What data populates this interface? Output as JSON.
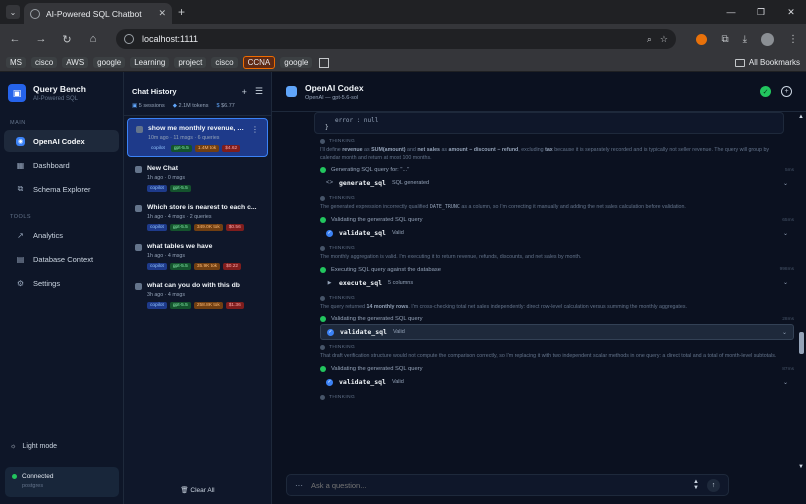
{
  "browser": {
    "tab_title": "AI-Powered SQL Chatbot",
    "url": "localhost:1111",
    "bookmarks": [
      "MS",
      "cisco",
      "AWS",
      "google",
      "Learning",
      "project",
      "cisco",
      "CCNA",
      "google"
    ],
    "highlighted_bookmark": "CCNA",
    "all_bookmarks": "All Bookmarks"
  },
  "sidebar": {
    "brand_name": "Query Bench",
    "brand_sub": "AI-Powered SQL",
    "section_main": "MAIN",
    "section_tools": "TOOLS",
    "main_items": [
      {
        "label": "OpenAI Codex",
        "icon": "codex-icon",
        "active": true
      },
      {
        "label": "Dashboard",
        "icon": "dashboard-icon",
        "active": false
      },
      {
        "label": "Schema Explorer",
        "icon": "schema-icon",
        "active": false
      }
    ],
    "tool_items": [
      {
        "label": "Analytics",
        "icon": "analytics-icon"
      },
      {
        "label": "Database Context",
        "icon": "database-icon"
      },
      {
        "label": "Settings",
        "icon": "gear-icon"
      }
    ],
    "light_mode": "Light mode",
    "connection_status": "Connected",
    "connection_db": "postgres"
  },
  "history": {
    "title": "Chat History",
    "stats": {
      "sessions": "5 sessions",
      "tokens": "2.1M tokens",
      "cost": "$6.77"
    },
    "chats": [
      {
        "title": "show me monthly revenue, refu...",
        "meta": "10m ago · 11 msgs · 6 queries",
        "badges": [
          {
            "t": "copilot",
            "c": "b-blue"
          },
          {
            "t": "gpt-5.5",
            "c": "b-green"
          },
          {
            "t": "1.4M tok",
            "c": "b-orange"
          },
          {
            "t": "$4.62",
            "c": "b-red"
          }
        ],
        "active": true
      },
      {
        "title": "New Chat",
        "meta": "1h ago · 0 msgs",
        "badges": [
          {
            "t": "copilot",
            "c": "b-blue"
          },
          {
            "t": "gpt-5.5",
            "c": "b-green"
          }
        ],
        "active": false
      },
      {
        "title": "Which store is nearest to each c...",
        "meta": "1h ago · 4 msgs · 2 queries",
        "badges": [
          {
            "t": "copilot",
            "c": "b-blue"
          },
          {
            "t": "gpt-5.5",
            "c": "b-green"
          },
          {
            "t": "349.0K tok",
            "c": "b-orange"
          },
          {
            "t": "$0.56",
            "c": "b-red"
          }
        ],
        "active": false
      },
      {
        "title": "what tables we have",
        "meta": "1h ago · 4 msgs",
        "badges": [
          {
            "t": "copilot",
            "c": "b-blue"
          },
          {
            "t": "gpt-5.5",
            "c": "b-green"
          },
          {
            "t": "35.9K tok",
            "c": "b-orange"
          },
          {
            "t": "$0.22",
            "c": "b-red"
          }
        ],
        "active": false
      },
      {
        "title": "what can you do with this db",
        "meta": "3h ago · 4 msgs",
        "badges": [
          {
            "t": "copilot",
            "c": "b-blue"
          },
          {
            "t": "gpt-5.5",
            "c": "b-green"
          },
          {
            "t": "258.8K tok",
            "c": "b-orange"
          },
          {
            "t": "$1.36",
            "c": "b-red"
          }
        ],
        "active": false
      }
    ],
    "clear_all": "Clear All"
  },
  "main": {
    "model_name": "OpenAI Codex",
    "model_sub": "OpenAI — gpt-5.6-sol",
    "code_tail": [
      "error : null",
      "}"
    ],
    "thinking_label": "THINKING",
    "feed": [
      {
        "kind": "thinking",
        "html": "I'll define <b>revenue</b> as <b>SUM(amount)</b> and <b>net sales</b> as <b>amount − discount − refund</b>, excluding <b>tax</b> because it is separately recorded and is typically not seller revenue. The query will group by calendar month and return at most 100 months."
      },
      {
        "kind": "status",
        "text": "Generating SQL query for: \"...\"",
        "time": "5ms"
      },
      {
        "kind": "tool",
        "icon": "code",
        "name": "generate_sql",
        "result": "SQL generated",
        "hl": false
      },
      {
        "kind": "thinking",
        "html": "The generated expression incorrectly qualified <code>DATE_TRUNC</code> as a column, so I'm correcting it manually and adding the net sales calculation before validation."
      },
      {
        "kind": "status",
        "text": "Validating the generated SQL query",
        "time": "65ms"
      },
      {
        "kind": "tool",
        "icon": "check",
        "name": "validate_sql",
        "result": "Valid",
        "hl": false
      },
      {
        "kind": "thinking",
        "html": "The monthly aggregation is valid. I'm executing it to return revenue, refunds, discounts, and net sales by month."
      },
      {
        "kind": "status",
        "text": "Executing SQL query against the database",
        "time": "998ms"
      },
      {
        "kind": "tool",
        "icon": "play",
        "name": "execute_sql",
        "result": "5 columns",
        "hl": false
      },
      {
        "kind": "thinking",
        "html": "The query returned <b>14 monthly rows</b>. I'm cross-checking total net sales independently: direct row-level calculation versus summing the monthly aggregates."
      },
      {
        "kind": "status",
        "text": "Validating the generated SQL query",
        "time": "28ms"
      },
      {
        "kind": "tool",
        "icon": "check",
        "name": "validate_sql",
        "result": "Valid",
        "hl": true
      },
      {
        "kind": "thinking",
        "html": "That draft verification structure would not compute the comparison correctly, so I'm replacing it with two independent scalar methods in one query: a direct total and a total of month-level subtotals."
      },
      {
        "kind": "status",
        "text": "Validating the generated SQL query",
        "time": "87ms"
      },
      {
        "kind": "tool",
        "icon": "check",
        "name": "validate_sql",
        "result": "Valid",
        "hl": false
      },
      {
        "kind": "thinking",
        "html": ""
      }
    ],
    "composer_placeholder": "Ask a question..."
  },
  "colors": {
    "accent": "#3b82f6",
    "success": "#22c55e",
    "bg": "#0b1120"
  }
}
